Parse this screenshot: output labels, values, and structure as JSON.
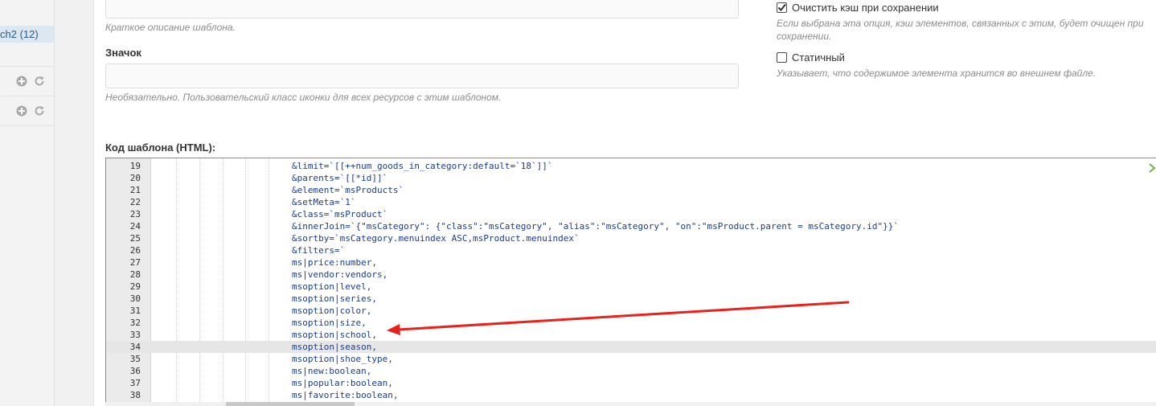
{
  "sidebar": {
    "tree_item_label": "ch2 (12)"
  },
  "form": {
    "description_help": "Краткое описание шаблона.",
    "icon_label": "Значок",
    "icon_value": "",
    "icon_help": "Необязательно. Пользовательский класс иконки для всех ресурсов с этим шаблоном.",
    "code_label": "Код шаблона (HTML):"
  },
  "options": {
    "clear_cache_label": "Очистить кэш при сохранении",
    "clear_cache_checked": true,
    "clear_cache_help_1": "Если выбрана эта опция, кэш элементов, связанных с этим, будет очищен при",
    "clear_cache_help_2": "сохранении.",
    "static_label": "Статичный",
    "static_checked": false,
    "static_help": "Указывает, что содержимое элемента хранится во внешнем файле."
  },
  "editor": {
    "active_line": 34,
    "lines": [
      {
        "n": "19",
        "text": "&limit=`[[++num_goods_in_category:default=`18`]]`"
      },
      {
        "n": "20",
        "text": "&parents=`[[*id]]`"
      },
      {
        "n": "21",
        "text": "&element=`msProducts`"
      },
      {
        "n": "22",
        "text": "&setMeta=`1`"
      },
      {
        "n": "23",
        "text": "&class=`msProduct`"
      },
      {
        "n": "24",
        "text": "&innerJoin=`{\"msCategory\": {\"class\":\"msCategory\", \"alias\":\"msCategory\", \"on\":\"msProduct.parent = msCategory.id\"}}`"
      },
      {
        "n": "25",
        "text": "&sortby=`msCategory.menuindex ASC,msProduct.menuindex`"
      },
      {
        "n": "26",
        "text": "&filters=`"
      },
      {
        "n": "27",
        "text": "ms|price:number,"
      },
      {
        "n": "28",
        "text": "ms|vendor:vendors,"
      },
      {
        "n": "29",
        "text": "msoption|level,"
      },
      {
        "n": "30",
        "text": "msoption|series,"
      },
      {
        "n": "31",
        "text": "msoption|color,"
      },
      {
        "n": "32",
        "text": "msoption|size,"
      },
      {
        "n": "33",
        "text": "msoption|school,"
      },
      {
        "n": "34",
        "text": "msoption|season,"
      },
      {
        "n": "35",
        "text": "msoption|shoe_type,"
      },
      {
        "n": "36",
        "text": "ms|new:boolean,"
      },
      {
        "n": "37",
        "text": "ms|popular:boolean,"
      },
      {
        "n": "38",
        "text": "ms|favorite:boolean,"
      }
    ]
  },
  "annotation": {
    "color": "#e8221b"
  },
  "colors": {
    "code_text": "#1a3c8f",
    "active_line_bg": "#e6e6e6",
    "sidebar_selected_bg": "#dce7f1"
  }
}
